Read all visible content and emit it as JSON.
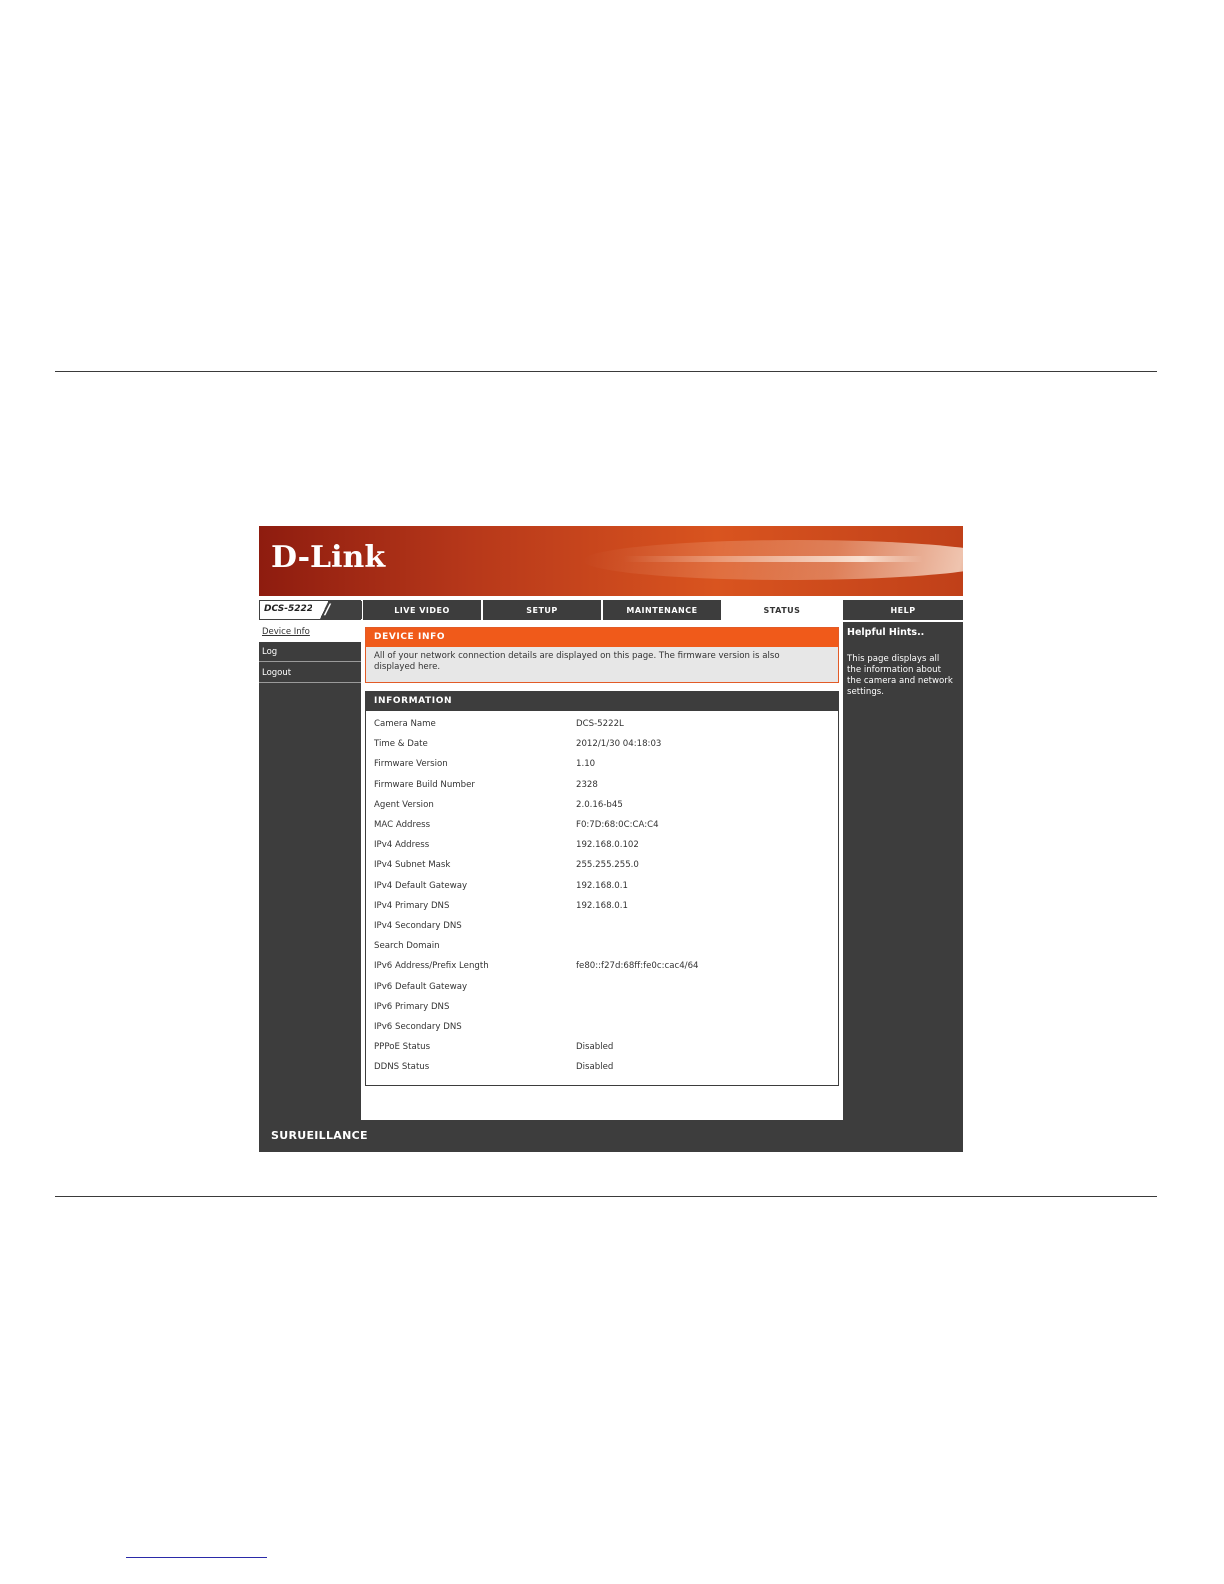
{
  "brand": {
    "logo_text": "D-Link",
    "model": "DCS-5222L",
    "slashes": "//",
    "footer": "SURUEILLANCE"
  },
  "nav": {
    "tabs": [
      {
        "label": "LIVE VIDEO"
      },
      {
        "label": "SETUP"
      },
      {
        "label": "MAINTENANCE"
      },
      {
        "label": "STATUS"
      },
      {
        "label": "HELP"
      }
    ]
  },
  "sidebar": {
    "items": [
      {
        "label": "Device Info"
      },
      {
        "label": "Log"
      },
      {
        "label": "Logout"
      }
    ]
  },
  "device_info": {
    "title": "DEVICE INFO",
    "description": "All of your network connection details are displayed on this page. The firmware version is also displayed here."
  },
  "information": {
    "title": "INFORMATION",
    "rows": [
      {
        "key": "Camera Name",
        "value": "DCS-5222L"
      },
      {
        "key": "Time & Date",
        "value": "2012/1/30 04:18:03"
      },
      {
        "key": "Firmware Version",
        "value": "1.10"
      },
      {
        "key": "Firmware Build Number",
        "value": "2328"
      },
      {
        "key": "Agent Version",
        "value": "2.0.16-b45"
      },
      {
        "key": "MAC Address",
        "value": "F0:7D:68:0C:CA:C4"
      },
      {
        "key": "IPv4 Address",
        "value": "192.168.0.102"
      },
      {
        "key": "IPv4 Subnet Mask",
        "value": "255.255.255.0"
      },
      {
        "key": "IPv4 Default Gateway",
        "value": "192.168.0.1"
      },
      {
        "key": "IPv4 Primary DNS",
        "value": "192.168.0.1"
      },
      {
        "key": "IPv4 Secondary DNS",
        "value": ""
      },
      {
        "key": "Search Domain",
        "value": ""
      },
      {
        "key": "IPv6 Address/Prefix Length",
        "value": "fe80::f27d:68ff:fe0c:cac4/64"
      },
      {
        "key": "IPv6 Default Gateway",
        "value": ""
      },
      {
        "key": "IPv6 Primary DNS",
        "value": ""
      },
      {
        "key": "IPv6 Secondary DNS",
        "value": ""
      },
      {
        "key": "PPPoE Status",
        "value": "Disabled"
      },
      {
        "key": "DDNS Status",
        "value": "Disabled"
      }
    ]
  },
  "help": {
    "title": "Helpful Hints..",
    "text": "This page displays all the information about the camera and network settings."
  },
  "colors": {
    "accent": "#f05a1a",
    "dark": "#3d3d3d",
    "banner": "#c04019"
  }
}
